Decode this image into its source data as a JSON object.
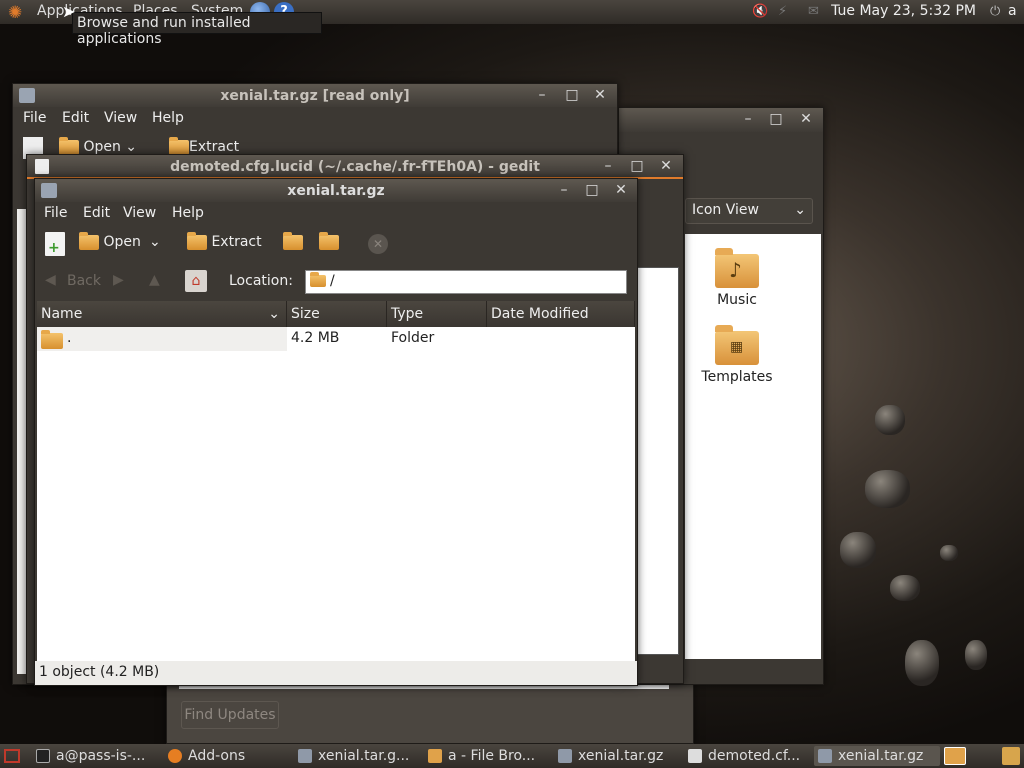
{
  "top_panel": {
    "menus": [
      "Applications",
      "Places",
      "System"
    ],
    "clock": "Tue May 23,  5:32 PM",
    "user": "a"
  },
  "tooltip": "Browse and run installed applications",
  "back_window": {
    "title": "xenial.tar.gz [read only]",
    "menus": [
      "File",
      "Edit",
      "View",
      "Help"
    ],
    "toolbar": {
      "open": "Open",
      "extract": "Extract"
    }
  },
  "file_browser": {
    "view_mode": "Icon View",
    "items": [
      {
        "label": "Music",
        "icon": "folder-music-icon"
      },
      {
        "label": "Templates",
        "icon": "folder-templates-icon"
      }
    ]
  },
  "update_manager": {
    "find_updates": "Find Updates"
  },
  "gedit": {
    "title": "demoted.cfg.lucid (~/.cache/.fr-fTEh0A) - gedit"
  },
  "front_window": {
    "title": "xenial.tar.gz",
    "menus": [
      "File",
      "Edit",
      "View",
      "Help"
    ],
    "toolbar": {
      "open": "Open",
      "extract": "Extract"
    },
    "nav": {
      "back": "Back",
      "location_label": "Location:",
      "location_value": "/"
    },
    "columns": [
      "Name",
      "Size",
      "Type",
      "Date Modified"
    ],
    "rows": [
      {
        "name": ".",
        "size": "4.2 MB",
        "type": "Folder",
        "modified": ""
      }
    ],
    "status": "1 object (4.2 MB)"
  },
  "taskbar": [
    {
      "label": "a@pass-is-..."
    },
    {
      "label": "Add-ons"
    },
    {
      "label": "xenial.tar.g..."
    },
    {
      "label": "a - File Bro..."
    },
    {
      "label": "xenial.tar.gz"
    },
    {
      "label": "demoted.cf..."
    },
    {
      "label": "xenial.tar.gz"
    }
  ],
  "colors": {
    "panel": "#3c3833",
    "accent": "#e07b2b"
  }
}
